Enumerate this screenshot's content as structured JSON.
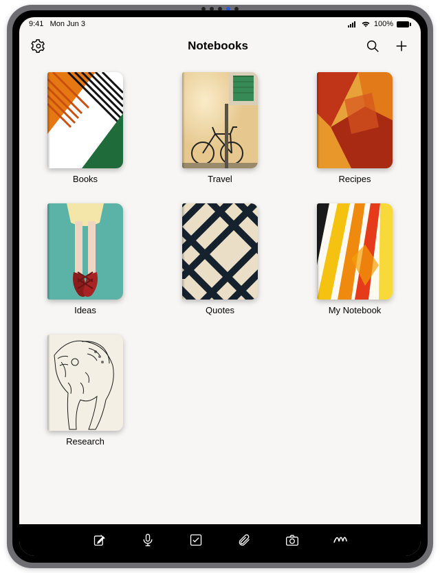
{
  "status": {
    "time": "9:41",
    "date": "Mon Jun 3",
    "battery": "100%"
  },
  "header": {
    "title": "Notebooks",
    "settings_icon": "settings",
    "search_icon": "search",
    "add_icon": "add"
  },
  "notebooks": [
    {
      "label": "Books"
    },
    {
      "label": "Travel"
    },
    {
      "label": "Recipes"
    },
    {
      "label": "Ideas"
    },
    {
      "label": "Quotes"
    },
    {
      "label": "My Notebook"
    },
    {
      "label": "Research"
    }
  ],
  "toolbar": {
    "compose_icon": "compose",
    "mic_icon": "microphone",
    "checklist_icon": "checklist",
    "attach_icon": "attachment",
    "camera_icon": "camera",
    "sketch_icon": "sketch"
  }
}
